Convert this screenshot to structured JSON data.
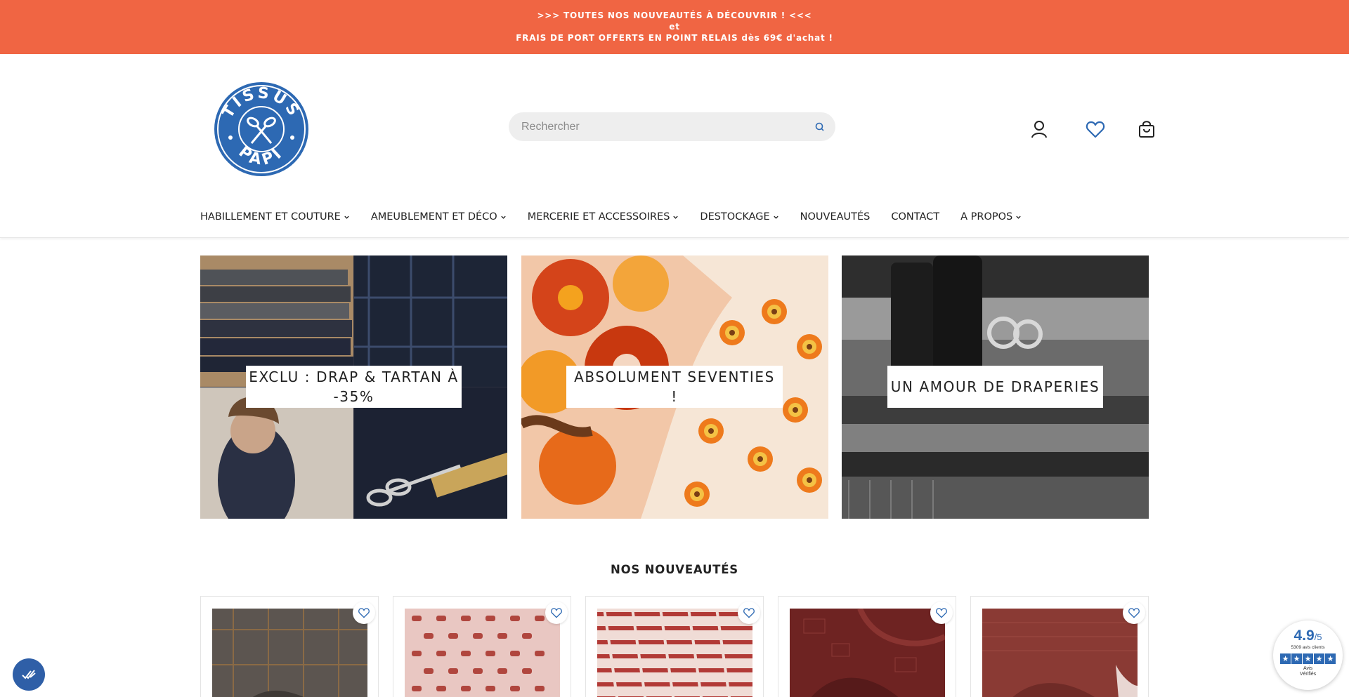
{
  "announcement": {
    "line1": ">>> TOUTES NOS NOUVEAUTÉS À DÉCOUVRIR ! <<<",
    "line2": "et",
    "line3": "FRAIS DE PORT OFFERTS EN POINT RELAIS dès 69€ d'achat !",
    "bg_color": "#f06543"
  },
  "header": {
    "logo": {
      "top_text": "TISSUS",
      "bottom_text": "PAPI",
      "color": "#2d69b3"
    },
    "search": {
      "placeholder": "Rechercher",
      "value": ""
    },
    "icons": [
      "account-icon",
      "heart-icon",
      "cart-icon"
    ]
  },
  "nav": {
    "items": [
      {
        "label": "HABILLEMENT ET COUTURE",
        "dropdown": true
      },
      {
        "label": "AMEUBLEMENT ET DÉCO",
        "dropdown": true
      },
      {
        "label": "MERCERIE ET ACCESSOIRES",
        "dropdown": true
      },
      {
        "label": "DESTOCKAGE",
        "dropdown": true
      },
      {
        "label": "NOUVEAUTÉS",
        "dropdown": false
      },
      {
        "label": "CONTACT",
        "dropdown": false
      },
      {
        "label": "A PROPOS",
        "dropdown": true
      }
    ]
  },
  "banners": [
    {
      "label": "EXCLU : DRAP & TARTAN À -35%"
    },
    {
      "label": "ABSOLUMENT SEVENTIES !"
    },
    {
      "label": "UN AMOUR DE DRAPERIES"
    }
  ],
  "new_arrivals": {
    "title": "NOS NOUVEAUTÉS",
    "products": [
      {
        "image": "grey-check-wool-fabric"
      },
      {
        "image": "pink-geometric-print-fabric"
      },
      {
        "image": "red-white-retro-print-fabric"
      },
      {
        "image": "burgundy-patterned-fabric"
      },
      {
        "image": "rust-patterned-fabric"
      }
    ]
  },
  "reviews_badge": {
    "score": "4.9",
    "scale": "/5",
    "count_text": "5309 avis clients",
    "brand_line1": "Avis",
    "brand_line2": "Vérifiés",
    "color": "#2d69b3"
  }
}
